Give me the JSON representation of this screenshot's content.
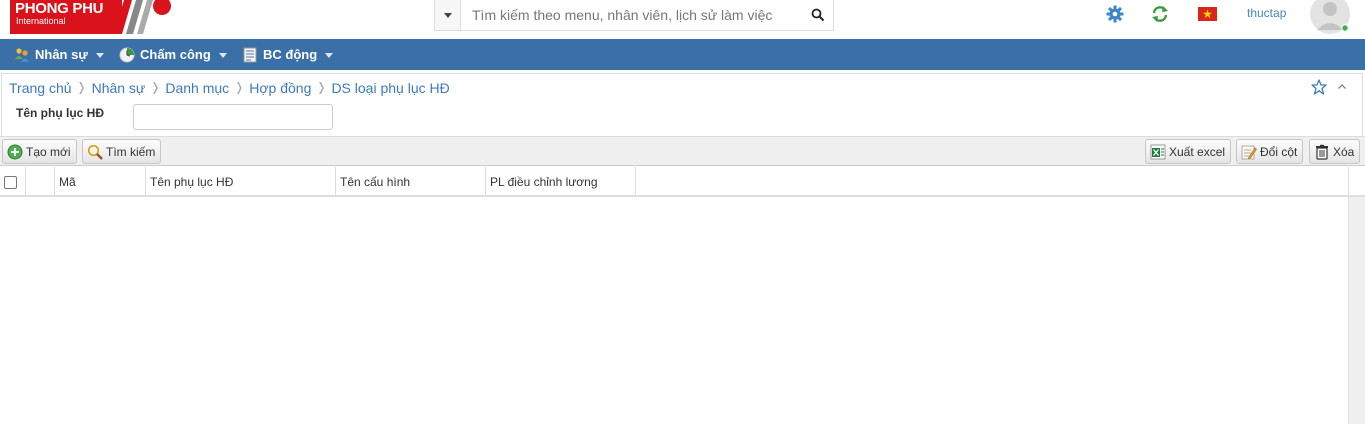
{
  "header": {
    "logo_text": "PHONG PHU",
    "logo_subtext": "International",
    "search_placeholder": "Tìm kiếm theo menu, nhân viên, lịch sử làm việc",
    "user_name": "thuctap"
  },
  "nav": {
    "items": [
      {
        "label": "Nhân sự"
      },
      {
        "label": "Chấm công"
      },
      {
        "label": "BC động"
      }
    ]
  },
  "breadcrumb": {
    "items": [
      "Trang chủ",
      "Nhân sự",
      "Danh mục",
      "Hợp đồng",
      "DS loại phụ lục HĐ"
    ]
  },
  "filter": {
    "label": "Tên phụ lục HĐ",
    "value": ""
  },
  "toolbar": {
    "create_label": "Tạo mới",
    "search_label": "Tìm kiếm",
    "export_label": "Xuất excel",
    "columns_label": "Đổi cột",
    "delete_label": "Xóa"
  },
  "grid": {
    "columns": [
      "Mã",
      "Tên phụ lục HĐ",
      "Tên cấu hình",
      "PL điều chỉnh lương"
    ],
    "rows": []
  },
  "colors": {
    "nav_bg": "#3a6fa8",
    "link": "#3d7ac1",
    "logo_red": "#d9121b"
  }
}
